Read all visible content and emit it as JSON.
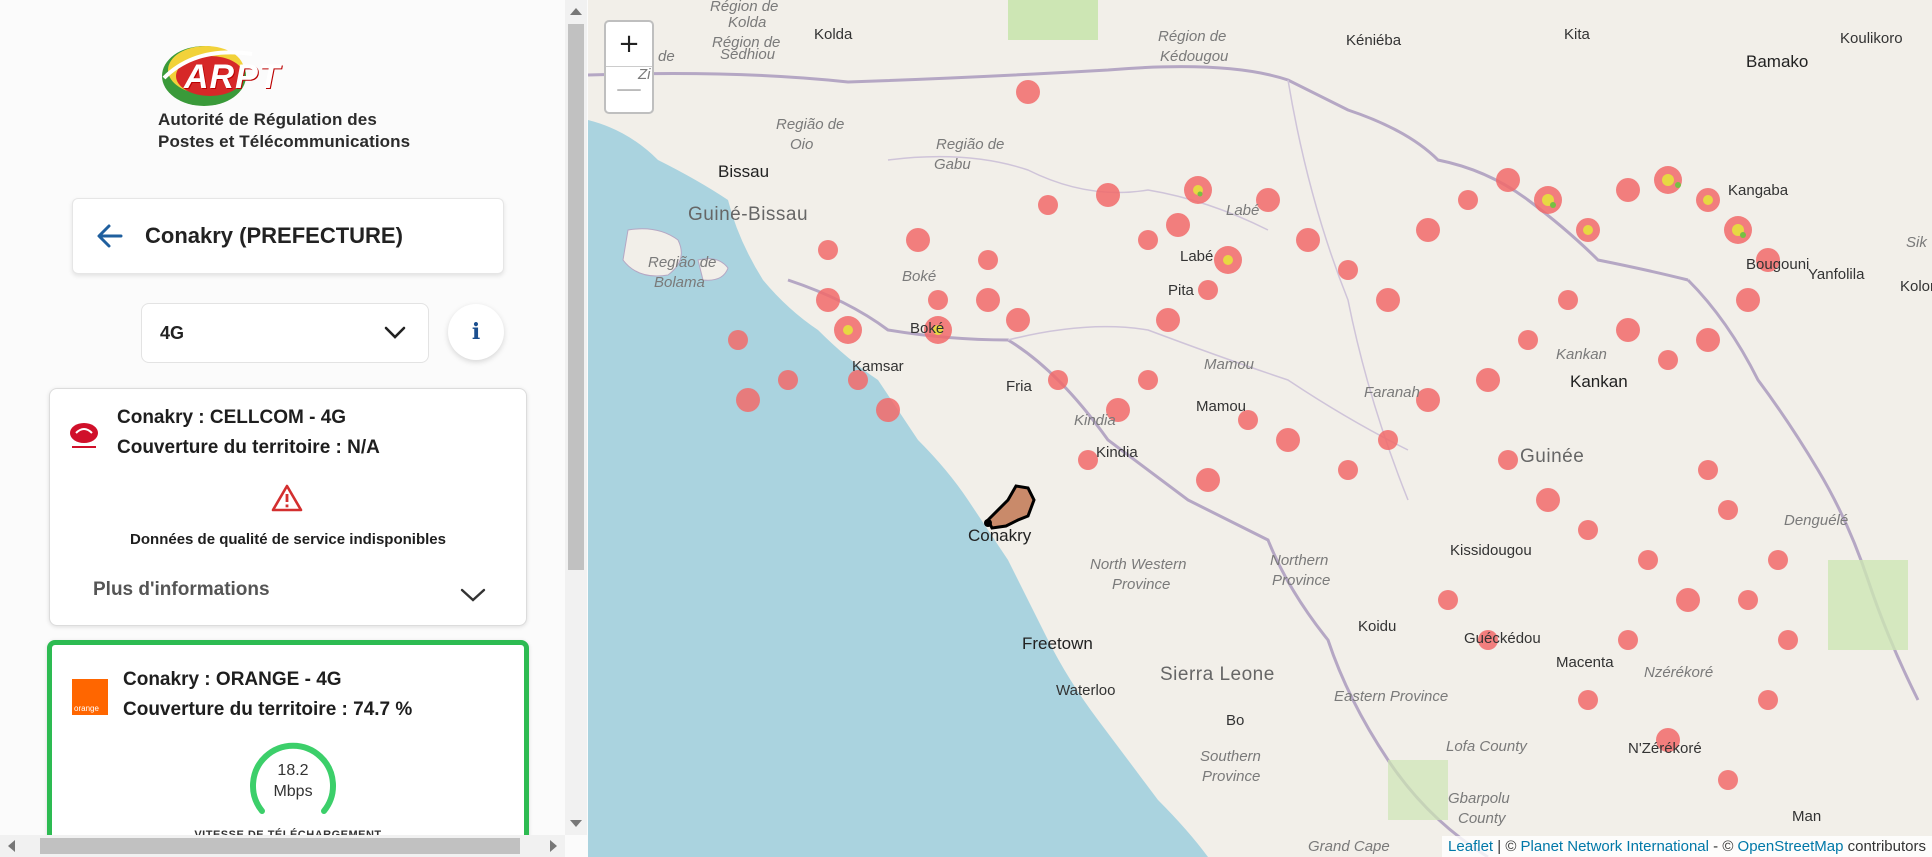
{
  "org": {
    "logo_text": "ARPT",
    "name_line1": "Autorité de Régulation des",
    "name_line2": "Postes et Télécommunications"
  },
  "header": {
    "title": "Conakry (PREFECTURE)"
  },
  "technology_select": {
    "value": "4G"
  },
  "info_button": {
    "label": "i"
  },
  "operators": [
    {
      "title": "Conakry : CELLCOM - 4G",
      "coverage": "Couverture du territoire : N/A",
      "message": "Données de qualité de service indisponibles",
      "more_info": "Plus d'informations"
    },
    {
      "logo_text": "orange",
      "title": "Conakry : ORANGE - 4G",
      "coverage": "Couverture du territoire : 74.7 %",
      "speed_value": "18.2",
      "speed_unit": "Mbps",
      "speed_label": "VITESSE DE TÉLÉCHARGEMENT"
    }
  ],
  "map": {
    "zoom_in": "+",
    "zoom_out": "—",
    "labels": {
      "kolda": "Kolda",
      "region_kolda_1": "Région de",
      "region_kolda_2": "Kolda",
      "region_sedhiou_1": "Région de",
      "region_sedhiou_2": "Sédhiou",
      "region_ziguinchor_1": "de",
      "region_ziguinchor_2": "Zi",
      "region_kedougou_1": "Région de",
      "region_kedougou_2": "Kédougou",
      "keniéba": "Kéniéba",
      "kita": "Kita",
      "bamako": "Bamako",
      "koulikoro": "Koulikoro",
      "regiao_oio_1": "Região de",
      "regiao_oio_2": "Oio",
      "regiao_gabu_1": "Região de",
      "regiao_gabu_2": "Gabu",
      "bissau": "Bissau",
      "guinee_bissau": "Guiné-Bissau",
      "regiao_bolama_1": "Região de",
      "regiao_bolama_2": "Bolama",
      "kangaba": "Kangaba",
      "labe_region": "Labé",
      "labe": "Labé",
      "pita": "Pita",
      "boke_region": "Boké",
      "boke": "Boké",
      "kamsar": "Kamsar",
      "mamou_region": "Mamou",
      "mamou": "Mamou",
      "fria": "Fria",
      "kindia_region": "Kindia",
      "kindia": "Kindia",
      "faranah": "Faranah",
      "kankan_region": "Kankan",
      "kankan": "Kankan",
      "guinee": "Guinée",
      "yanfolila": "Yanfolila",
      "bougouni": "Bougouni",
      "kolon": "Kolon",
      "sik": "Sik",
      "conakry": "Conakry",
      "nw_province_1": "North Western",
      "nw_province_2": "Province",
      "northern_province_1": "Northern",
      "northern_province_2": "Province",
      "kissidougou": "Kissidougou",
      "denguele": "Denguélé",
      "freetown": "Freetown",
      "sierra_leone": "Sierra Leone",
      "koidu": "Koidu",
      "gueckedou": "Guéckédou",
      "macenta": "Macenta",
      "nzerekore_region": "Nzérékoré",
      "waterloo": "Waterloo",
      "eastern_province": "Eastern Province",
      "bo": "Bo",
      "southern_province_1": "Southern",
      "southern_province_2": "Province",
      "lofa_county": "Lofa County",
      "nzerekore": "N'Zérékoré",
      "gbarpolu_1": "Gbarpolu",
      "gbarpolu_2": "County",
      "man": "Man",
      "grand_cape": "Grand Cape"
    },
    "attribution": {
      "leaflet": "Leaflet",
      "sep1": " | © ",
      "pni": "Planet Network International",
      "sep2": " - © ",
      "osm": "OpenStreetMap",
      "tail": " contributors"
    },
    "colors": {
      "coverage_red": "#f26b6b",
      "coverage_yellow": "#e6e23c",
      "coverage_green": "#76c043",
      "sea": "#aad3df"
    }
  }
}
